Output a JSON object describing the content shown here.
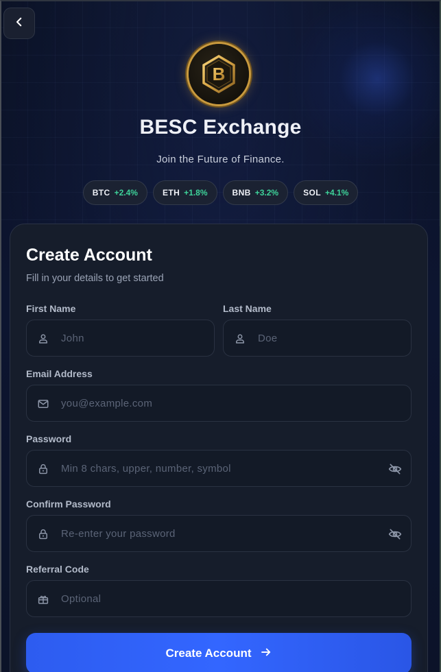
{
  "brand": {
    "name": "BESC Exchange",
    "tagline": "Join the Future of Finance.",
    "logo_letter": "B",
    "accent_gold": "#c99a3e"
  },
  "tickers": [
    {
      "symbol": "BTC",
      "change": "+2.4%"
    },
    {
      "symbol": "ETH",
      "change": "+1.8%"
    },
    {
      "symbol": "BNB",
      "change": "+3.2%"
    },
    {
      "symbol": "SOL",
      "change": "+4.1%"
    }
  ],
  "form": {
    "title": "Create Account",
    "subtitle": "Fill in your details to get started",
    "first_name": {
      "label": "First Name",
      "placeholder": "John",
      "value": "",
      "icon": "user-icon"
    },
    "last_name": {
      "label": "Last Name",
      "placeholder": "Doe",
      "value": "",
      "icon": "user-icon"
    },
    "email": {
      "label": "Email Address",
      "placeholder": "you@example.com",
      "value": "",
      "icon": "mail-icon"
    },
    "password": {
      "label": "Password",
      "placeholder": "Min 8 chars, upper, number, symbol",
      "value": "",
      "icon": "lock-icon",
      "toggle_icon": "eye-off-icon"
    },
    "confirm_password": {
      "label": "Confirm Password",
      "placeholder": "Re-enter your password",
      "value": "",
      "icon": "lock-icon",
      "toggle_icon": "eye-off-icon"
    },
    "referral": {
      "label": "Referral Code",
      "placeholder": "Optional",
      "value": "",
      "icon": "gift-icon"
    },
    "submit_label": "Create Account",
    "submit_icon": "arrow-right-icon"
  },
  "colors": {
    "primary": "#3366ff",
    "positive": "#3ed39a",
    "background": "#0c1329"
  }
}
